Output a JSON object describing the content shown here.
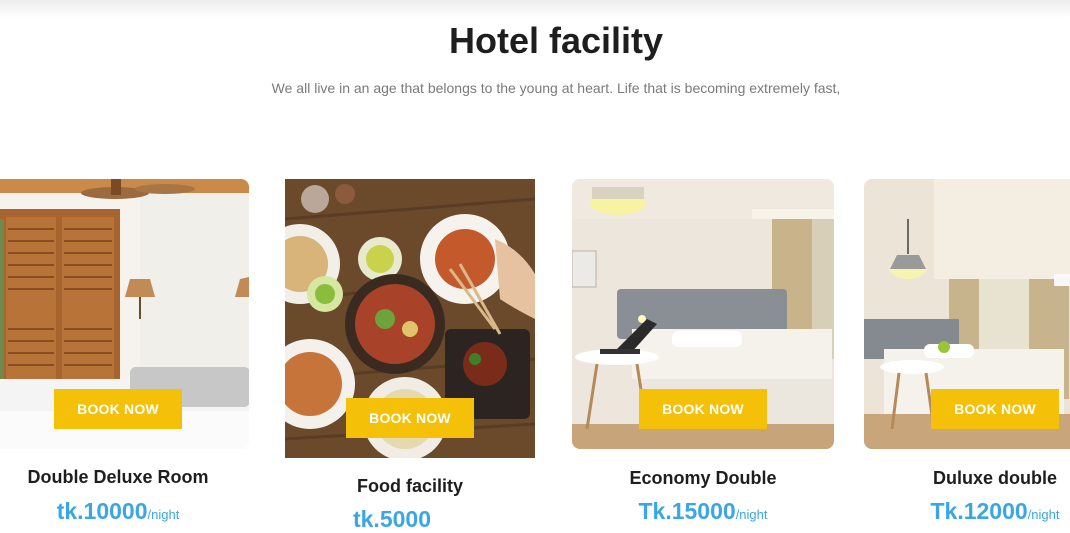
{
  "section": {
    "title": "Hotel facility",
    "subtitle": "We all live in an age that belongs to the young at heart. Life that is becoming extremely fast,"
  },
  "cards": [
    {
      "title": "Double Deluxe Room",
      "button": "BOOK NOW",
      "price": "tk.10000",
      "unit": "/night"
    },
    {
      "title": "Food facility",
      "button": "BOOK NOW",
      "price": "tk.5000",
      "unit": ""
    },
    {
      "title": "Economy Double",
      "button": "BOOK NOW",
      "price": "Tk.15000",
      "unit": "/night"
    },
    {
      "title": "Duluxe double",
      "button": "BOOK NOW",
      "price": "Tk.12000",
      "unit": "/night"
    }
  ],
  "colors": {
    "accent": "#f4c008",
    "price": "#3aa7e4",
    "heading": "#1e1e1e",
    "subtitle": "#7a7a7a"
  }
}
